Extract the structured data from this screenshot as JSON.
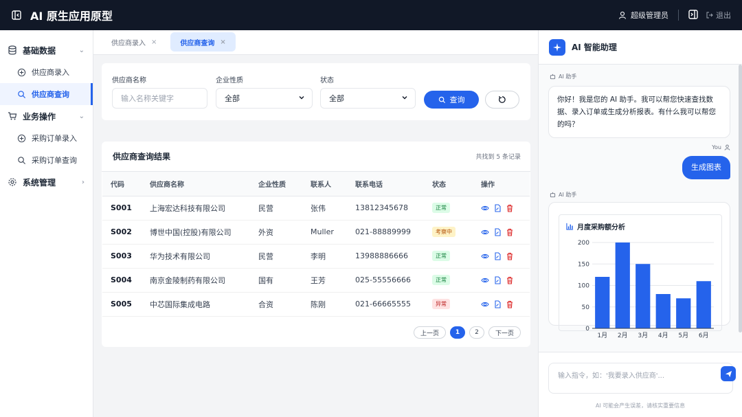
{
  "header": {
    "title": "AI 原生应用原型",
    "user": "超级管理员",
    "logout": "退出"
  },
  "sidebar": {
    "groups": [
      {
        "label": "基础数据",
        "items": [
          "供应商录入",
          "供应商查询"
        ]
      },
      {
        "label": "业务操作",
        "items": [
          "采购订单录入",
          "采购订单查询"
        ]
      },
      {
        "label": "系统管理"
      }
    ]
  },
  "tabs": [
    {
      "label": "供应商录入"
    },
    {
      "label": "供应商查询",
      "active": true
    }
  ],
  "filter": {
    "name_label": "供应商名称",
    "name_placeholder": "输入名称关键字",
    "type_label": "企业性质",
    "type_value": "全部",
    "status_label": "状态",
    "status_value": "全部",
    "query_btn": "查询"
  },
  "results": {
    "title": "供应商查询结果",
    "count_text": "共找到 5 条记录",
    "columns": [
      "代码",
      "供应商名称",
      "企业性质",
      "联系人",
      "联系电话",
      "状态",
      "操作"
    ],
    "rows": [
      {
        "code": "S001",
        "name": "上海宏达科技有限公司",
        "type": "民营",
        "contact": "张伟",
        "phone": "13812345678",
        "status": "正常",
        "status_kind": "ok"
      },
      {
        "code": "S002",
        "name": "博世中国(控股)有限公司",
        "type": "外资",
        "contact": "Muller",
        "phone": "021-88889999",
        "status": "考察中",
        "status_kind": "rev"
      },
      {
        "code": "S003",
        "name": "华为技术有限公司",
        "type": "民营",
        "contact": "李明",
        "phone": "13988886666",
        "status": "正常",
        "status_kind": "ok"
      },
      {
        "code": "S004",
        "name": "南京金陵制药有限公司",
        "type": "国有",
        "contact": "王芳",
        "phone": "025-55556666",
        "status": "正常",
        "status_kind": "ok"
      },
      {
        "code": "S005",
        "name": "中芯国际集成电路",
        "type": "合资",
        "contact": "陈刚",
        "phone": "021-66665555",
        "status": "异常",
        "status_kind": "err"
      }
    ],
    "pager": {
      "prev": "上一页",
      "pages": [
        "1",
        "2"
      ],
      "current": "1",
      "next": "下一页"
    }
  },
  "ai_panel": {
    "title": "AI 智能助理",
    "assistant_label": "AI 助手",
    "user_label": "You",
    "greeting": "你好！我是您的 AI 助手。我可以帮您快速查找数据、录入订单或生成分析报表。有什么我可以帮您的吗？",
    "user_message": "生成图表",
    "input_placeholder": "输入指令，如：'我要录入供应商'...",
    "disclaimer": "AI 可能会产生误差，请核实重要信息"
  },
  "chart_data": {
    "type": "bar",
    "title": "月度采购额分析",
    "categories": [
      "1月",
      "2月",
      "3月",
      "4月",
      "5月",
      "6月"
    ],
    "values": [
      120,
      200,
      150,
      80,
      70,
      110
    ],
    "ylim": [
      0,
      200
    ],
    "yticks": [
      0,
      50,
      100,
      150,
      200
    ],
    "color": "#2563eb",
    "grid": true
  },
  "colors": {
    "accent": "#2563eb",
    "topbar": "#111827"
  }
}
